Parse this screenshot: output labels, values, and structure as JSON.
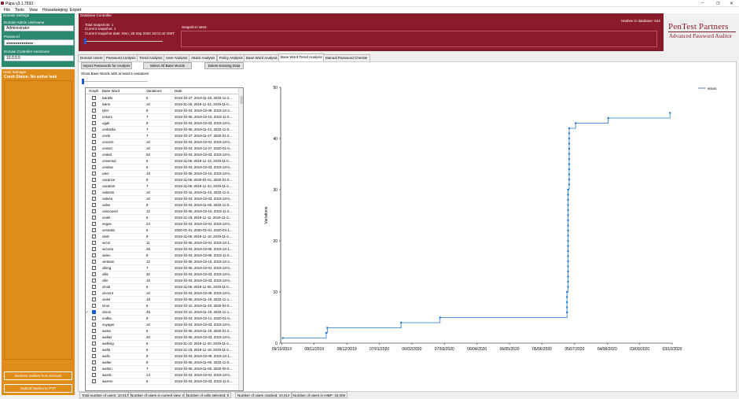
{
  "window": {
    "title": "Papa v3.1.7593"
  },
  "menu": [
    "File",
    "Tools",
    "View",
    "Housekeeping",
    "Export"
  ],
  "domain_settings": {
    "header": "Domain Settings",
    "admin_label": "Domain Admin Username",
    "admin_value": "Administrator",
    "password_label": "Password",
    "password_value": "●●●●●●●●●●●●●●",
    "dc_label": "Domain Controller Hostname",
    "dc_value": "10.0.5.5"
  },
  "hash_manager": {
    "header": "Hash Manager",
    "status": "Crack Status: No active task",
    "retrieve_label": "Retrieve hashes from Domain",
    "submit_label": "Submit hashes to PTP"
  },
  "database_controller": {
    "header": "Database Controller",
    "total_snapshots": "Total snapshots: 1",
    "current_snapshot": "Current snapshot: 1",
    "current_date": "Current snapshot date:  Mon, 28 Sep 2020 15:01:42 GMT",
    "notes_label": "Snapshot notes:",
    "hashes_in_db": "Hashes in database: 544"
  },
  "logo": {
    "line1": "PenTest Partners",
    "line2": "Advanced Password Auditor"
  },
  "tabs": [
    "Domain Users",
    "Password Analysis",
    "Trend Analysis",
    "User Analysis",
    "Attack Analysis",
    "Policy Analysis",
    "Base Word Analysis",
    "Base Word Trend Analysis",
    "Manual Password Checker"
  ],
  "active_tab": 7,
  "toolbar": {
    "import_label": "Import Passwords for Analysis",
    "select_all_label": "Select All Base Words",
    "delete_label": "Delete Existing Data",
    "filter_label": "Show Base Words with at least 6 variations"
  },
  "grid": {
    "columns": [
      "Graph",
      "Base Word",
      "Variations",
      "Date"
    ],
    "rows": [
      [
        "twinkle",
        "6",
        "2019-10-27, 2019-11-20, 2019-11-2..."
      ],
      [
        "twins",
        "10",
        "2019-11-26, 2019-11-24, 2019-11-0..."
      ],
      [
        "tyler",
        "8",
        "2019-10-04, 2019-10-09, 2019-10-2..."
      ],
      [
        "uckers",
        "7",
        "2019-10-05, 2019-10-10, 2019-11-0..."
      ],
      [
        "ugali",
        "9",
        "2019-10-03, 2019-10-03, 2019-10-0..."
      ],
      [
        "umbrella",
        "7",
        "2019-10-05, 2019-11-24, 2019-11-0..."
      ],
      [
        "uncle",
        "7",
        "2019-10-27, 2019-11-27, 2020-01-2..."
      ],
      [
        "unicorn",
        "10",
        "2019-10-03, 2019-10-04, 2019-10-0..."
      ],
      [
        "unison",
        "10",
        "2019-10-04, 2019-12-27, 2020-01-0..."
      ],
      [
        "united",
        "62",
        "2019-10-03, 2019-10-03, 2019-10-0..."
      ],
      [
        "universal",
        "6",
        "2019-11-06, 2019-11-13, 2019-11-0..."
      ],
      [
        "unslow",
        "6",
        "2019-10-03, 2019-10-03, 2019-10-0..."
      ],
      [
        "uteri",
        "19",
        "2019-10-09, 2019-10-10, 2019-10-0..."
      ],
      [
        "vacance",
        "8",
        "2019-11-06, 2020-01-01, 2020-01-0..."
      ],
      [
        "vacation",
        "7",
        "2019-11-06, 2019-11-23, 2019-11-2..."
      ],
      [
        "valentin",
        "10",
        "2019-10-16, 2019-11-23, 2019-11-2..."
      ],
      [
        "valeria",
        "10",
        "2019-10-04, 2019-10-03, 2019-10-0..."
      ],
      [
        "valse",
        "9",
        "2019-10-03, 2019-11-06, 2019-11-0..."
      ],
      [
        "vancouver",
        "12",
        "2019-10-05, 2019-10-10, 2019-11-2..."
      ],
      [
        "veals",
        "6",
        "2019-11-18, 2019-11-11, 2019-11-2..."
      ],
      [
        "vegas",
        "24",
        "2019-10-04, 2019-10-04, 2019-10-0..."
      ],
      [
        "veranda",
        "6",
        "2020-01-01, 2020-01-01, 2020-03-1..."
      ],
      [
        "vials",
        "9",
        "2019-11-06, 2019-11-18, 2019-11-2..."
      ],
      [
        "victor",
        "11",
        "2019-10-05, 2019-10-04, 2019-10-1..."
      ],
      [
        "victoria",
        "26",
        "2019-10-03, 2019-10-05, 2019-10-1..."
      ],
      [
        "video",
        "8",
        "2019-10-03, 2019-10-05, 2019-11-0..."
      ],
      [
        "vietnam",
        "12",
        "2019-10-09, 2019-10-15, 2019-10-2..."
      ],
      [
        "viking",
        "7",
        "2019-10-05, 2019-10-04, 2019-10-0..."
      ],
      [
        "villa",
        "32",
        "2019-10-03, 2019-10-03, 2019-10-0..."
      ],
      [
        "ville",
        "15",
        "2019-10-03, 2019-10-03, 2019-10-0..."
      ],
      [
        "vinial",
        "6",
        "2019-11-06, 2019-11-06, 2019-11-0..."
      ],
      [
        "vincent",
        "10",
        "2019-10-03, 2019-10-09, 2019-10-0..."
      ],
      [
        "violet",
        "18",
        "2019-10-05, 2019-11-19, 2019-11-1..."
      ],
      [
        "virus",
        "6",
        "2019-10-10, 2019-11-20, 2020-04-0..."
      ],
      [
        "vision",
        "45",
        "2019-10-10, 2019-11-19, 2019-11-1..."
      ],
      [
        "vodka",
        "9",
        "2019-10-04, 2019-10-12, 2020-01-0..."
      ],
      [
        "voyager",
        "10",
        "2019-10-04, 2019-10-03, 2019-10-0..."
      ],
      [
        "wales",
        "6",
        "2019-10-05, 2019-11-19, 2020-01-2..."
      ],
      [
        "walker",
        "20",
        "2019-10-05, 2019-10-03, 2019-10-0..."
      ],
      [
        "walking",
        "6",
        "2019-11-20, 2019-11-20, 2019-11-2..."
      ],
      [
        "walla",
        "6",
        "2019-11-18, 2019-11-19, 2019-11-2..."
      ],
      [
        "walls",
        "9",
        "2019-10-03, 2019-10-08, 2019-10-1..."
      ],
      [
        "walter",
        "8",
        "2019-10-05, 2019-11-08, 2019-11-0..."
      ],
      [
        "walton",
        "7",
        "2019-10-05, 2019-11-06, 2020-02-0..."
      ],
      [
        "wards",
        "14",
        "2019-10-04, 2019-10-04, 2019-10-0..."
      ],
      [
        "warren",
        "6",
        "2019-10-03, 2019-10-03, 2019-11-0..."
      ]
    ],
    "selected_row": 34
  },
  "status": [
    "Total number of users: 10,017",
    "Number of users in current view: 0",
    "Number of cells selected: 0",
    "Number of users cracked: 10,012",
    "Number of users in HIBP: 10,009"
  ],
  "chart_data": {
    "type": "line",
    "title": "",
    "xlabel": "",
    "ylabel": "Variations",
    "ylim": [
      0,
      50
    ],
    "xlim": [
      "2019-10-08",
      "2020-10-03"
    ],
    "x_ticks": [
      "09/10/2019",
      "08/11/2019",
      "08/12/2019",
      "07/01/2020",
      "06/02/2020",
      "07/03/2020",
      "06/04/2020",
      "06/05/2020",
      "05/06/2020",
      "05/07/2020",
      "04/08/2020",
      "03/09/2020",
      "03/10/2020"
    ],
    "y_ticks": [
      0,
      10,
      20,
      30,
      40,
      50
    ],
    "legend": "top-right",
    "series": [
      {
        "name": "vision",
        "color": "#1f77d4",
        "points": [
          [
            "2019-10-10",
            1
          ],
          [
            "2019-11-19",
            2
          ],
          [
            "2019-11-20",
            3
          ],
          [
            "2020-01-27",
            4
          ],
          [
            "2020-03-03",
            5
          ],
          [
            "2020-06-28",
            6
          ],
          [
            "2020-06-28",
            7
          ],
          [
            "2020-06-28",
            8
          ],
          [
            "2020-06-28",
            9
          ],
          [
            "2020-06-28",
            10
          ],
          [
            "2020-06-29",
            11
          ],
          [
            "2020-06-29",
            12
          ],
          [
            "2020-06-29",
            13
          ],
          [
            "2020-06-29",
            14
          ],
          [
            "2020-06-29",
            15
          ],
          [
            "2020-06-29",
            16
          ],
          [
            "2020-06-29",
            17
          ],
          [
            "2020-06-29",
            18
          ],
          [
            "2020-06-29",
            19
          ],
          [
            "2020-06-29",
            20
          ],
          [
            "2020-06-29",
            21
          ],
          [
            "2020-06-29",
            22
          ],
          [
            "2020-06-29",
            23
          ],
          [
            "2020-06-29",
            24
          ],
          [
            "2020-06-29",
            25
          ],
          [
            "2020-06-29",
            26
          ],
          [
            "2020-06-29",
            27
          ],
          [
            "2020-06-29",
            28
          ],
          [
            "2020-06-29",
            29
          ],
          [
            "2020-06-29",
            30
          ],
          [
            "2020-06-30",
            31
          ],
          [
            "2020-06-30",
            32
          ],
          [
            "2020-06-30",
            33
          ],
          [
            "2020-06-30",
            34
          ],
          [
            "2020-06-30",
            35
          ],
          [
            "2020-06-30",
            36
          ],
          [
            "2020-06-30",
            37
          ],
          [
            "2020-06-30",
            38
          ],
          [
            "2020-06-30",
            39
          ],
          [
            "2020-06-30",
            40
          ],
          [
            "2020-06-30",
            41
          ],
          [
            "2020-06-30",
            42
          ],
          [
            "2020-07-06",
            43
          ],
          [
            "2020-08-05",
            44
          ],
          [
            "2020-10-01",
            45
          ]
        ]
      }
    ]
  }
}
